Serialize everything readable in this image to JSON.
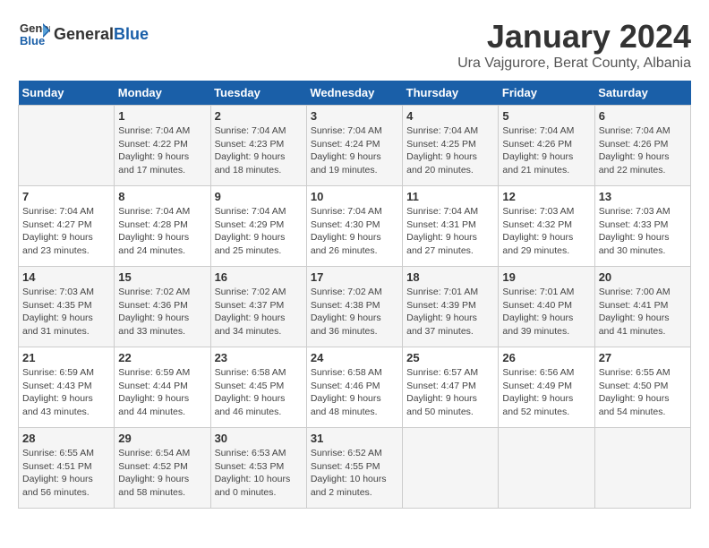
{
  "header": {
    "logo_general": "General",
    "logo_blue": "Blue",
    "main_title": "January 2024",
    "subtitle": "Ura Vajgurore, Berat County, Albania"
  },
  "weekdays": [
    "Sunday",
    "Monday",
    "Tuesday",
    "Wednesday",
    "Thursday",
    "Friday",
    "Saturday"
  ],
  "weeks": [
    [
      {
        "day": "",
        "info": ""
      },
      {
        "day": "1",
        "info": "Sunrise: 7:04 AM\nSunset: 4:22 PM\nDaylight: 9 hours\nand 17 minutes."
      },
      {
        "day": "2",
        "info": "Sunrise: 7:04 AM\nSunset: 4:23 PM\nDaylight: 9 hours\nand 18 minutes."
      },
      {
        "day": "3",
        "info": "Sunrise: 7:04 AM\nSunset: 4:24 PM\nDaylight: 9 hours\nand 19 minutes."
      },
      {
        "day": "4",
        "info": "Sunrise: 7:04 AM\nSunset: 4:25 PM\nDaylight: 9 hours\nand 20 minutes."
      },
      {
        "day": "5",
        "info": "Sunrise: 7:04 AM\nSunset: 4:26 PM\nDaylight: 9 hours\nand 21 minutes."
      },
      {
        "day": "6",
        "info": "Sunrise: 7:04 AM\nSunset: 4:26 PM\nDaylight: 9 hours\nand 22 minutes."
      }
    ],
    [
      {
        "day": "7",
        "info": ""
      },
      {
        "day": "8",
        "info": "Sunrise: 7:04 AM\nSunset: 4:28 PM\nDaylight: 9 hours\nand 24 minutes."
      },
      {
        "day": "9",
        "info": "Sunrise: 7:04 AM\nSunset: 4:29 PM\nDaylight: 9 hours\nand 25 minutes."
      },
      {
        "day": "10",
        "info": "Sunrise: 7:04 AM\nSunset: 4:30 PM\nDaylight: 9 hours\nand 26 minutes."
      },
      {
        "day": "11",
        "info": "Sunrise: 7:04 AM\nSunset: 4:31 PM\nDaylight: 9 hours\nand 27 minutes."
      },
      {
        "day": "12",
        "info": "Sunrise: 7:03 AM\nSunset: 4:32 PM\nDaylight: 9 hours\nand 29 minutes."
      },
      {
        "day": "13",
        "info": "Sunrise: 7:03 AM\nSunset: 4:33 PM\nDaylight: 9 hours\nand 30 minutes."
      }
    ],
    [
      {
        "day": "14",
        "info": ""
      },
      {
        "day": "15",
        "info": "Sunrise: 7:02 AM\nSunset: 4:36 PM\nDaylight: 9 hours\nand 33 minutes."
      },
      {
        "day": "16",
        "info": "Sunrise: 7:02 AM\nSunset: 4:37 PM\nDaylight: 9 hours\nand 34 minutes."
      },
      {
        "day": "17",
        "info": "Sunrise: 7:02 AM\nSunset: 4:38 PM\nDaylight: 9 hours\nand 36 minutes."
      },
      {
        "day": "18",
        "info": "Sunrise: 7:01 AM\nSunset: 4:39 PM\nDaylight: 9 hours\nand 37 minutes."
      },
      {
        "day": "19",
        "info": "Sunrise: 7:01 AM\nSunset: 4:40 PM\nDaylight: 9 hours\nand 39 minutes."
      },
      {
        "day": "20",
        "info": "Sunrise: 7:00 AM\nSunset: 4:41 PM\nDaylight: 9 hours\nand 41 minutes."
      }
    ],
    [
      {
        "day": "21",
        "info": "Sunrise: 6:59 AM\nSunset: 4:43 PM\nDaylight: 9 hours\nand 43 minutes."
      },
      {
        "day": "22",
        "info": "Sunrise: 6:59 AM\nSunset: 4:44 PM\nDaylight: 9 hours\nand 44 minutes."
      },
      {
        "day": "23",
        "info": "Sunrise: 6:58 AM\nSunset: 4:45 PM\nDaylight: 9 hours\nand 46 minutes."
      },
      {
        "day": "24",
        "info": "Sunrise: 6:58 AM\nSunset: 4:46 PM\nDaylight: 9 hours\nand 48 minutes."
      },
      {
        "day": "25",
        "info": "Sunrise: 6:57 AM\nSunset: 4:47 PM\nDaylight: 9 hours\nand 50 minutes."
      },
      {
        "day": "26",
        "info": "Sunrise: 6:56 AM\nSunset: 4:49 PM\nDaylight: 9 hours\nand 52 minutes."
      },
      {
        "day": "27",
        "info": "Sunrise: 6:55 AM\nSunset: 4:50 PM\nDaylight: 9 hours\nand 54 minutes."
      }
    ],
    [
      {
        "day": "28",
        "info": "Sunrise: 6:55 AM\nSunset: 4:51 PM\nDaylight: 9 hours\nand 56 minutes."
      },
      {
        "day": "29",
        "info": "Sunrise: 6:54 AM\nSunset: 4:52 PM\nDaylight: 9 hours\nand 58 minutes."
      },
      {
        "day": "30",
        "info": "Sunrise: 6:53 AM\nSunset: 4:53 PM\nDaylight: 10 hours\nand 0 minutes."
      },
      {
        "day": "31",
        "info": "Sunrise: 6:52 AM\nSunset: 4:55 PM\nDaylight: 10 hours\nand 2 minutes."
      },
      {
        "day": "",
        "info": ""
      },
      {
        "day": "",
        "info": ""
      },
      {
        "day": "",
        "info": ""
      }
    ]
  ],
  "week2_sunday": {
    "info": "Sunrise: 7:04 AM\nSunset: 4:27 PM\nDaylight: 9 hours\nand 23 minutes."
  },
  "week3_sunday": {
    "info": "Sunrise: 7:03 AM\nSunset: 4:35 PM\nDaylight: 9 hours\nand 31 minutes."
  }
}
